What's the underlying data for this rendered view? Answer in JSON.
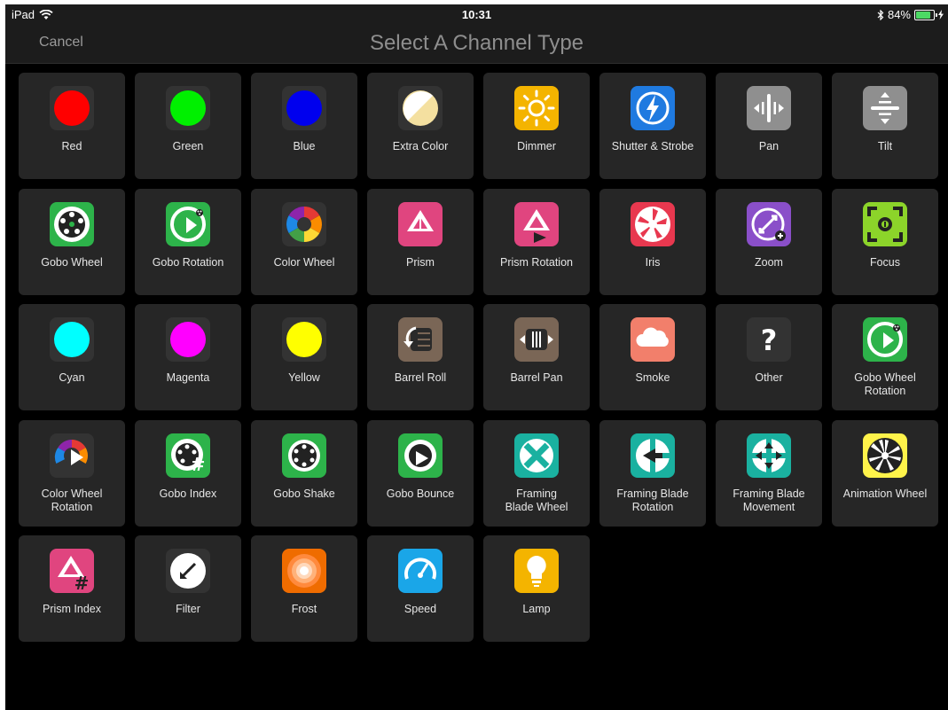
{
  "status_bar": {
    "device": "iPad",
    "time": "10:31",
    "battery_text": "84%",
    "battery_level": 0.84
  },
  "nav": {
    "cancel_label": "Cancel",
    "title": "Select A Channel Type"
  },
  "channels": [
    {
      "label": "Red",
      "icon": "red-color-icon"
    },
    {
      "label": "Green",
      "icon": "green-color-icon"
    },
    {
      "label": "Blue",
      "icon": "blue-color-icon"
    },
    {
      "label": "Extra Color",
      "icon": "extra-color-icon"
    },
    {
      "label": "Dimmer",
      "icon": "dimmer-sun-icon"
    },
    {
      "label": "Shutter & Strobe",
      "icon": "shutter-strobe-bolt-icon"
    },
    {
      "label": "Pan",
      "icon": "pan-icon"
    },
    {
      "label": "Tilt",
      "icon": "tilt-icon"
    },
    {
      "label": "Gobo Wheel",
      "icon": "gobo-wheel-icon"
    },
    {
      "label": "Gobo Rotation",
      "icon": "gobo-rotation-icon"
    },
    {
      "label": "Color Wheel",
      "icon": "color-wheel-icon"
    },
    {
      "label": "Prism",
      "icon": "prism-icon"
    },
    {
      "label": "Prism Rotation",
      "icon": "prism-rotation-icon"
    },
    {
      "label": "Iris",
      "icon": "iris-icon"
    },
    {
      "label": "Zoom",
      "icon": "zoom-icon"
    },
    {
      "label": "Focus",
      "icon": "focus-icon"
    },
    {
      "label": "Cyan",
      "icon": "cyan-color-icon"
    },
    {
      "label": "Magenta",
      "icon": "magenta-color-icon"
    },
    {
      "label": "Yellow",
      "icon": "yellow-color-icon"
    },
    {
      "label": "Barrel Roll",
      "icon": "barrel-roll-icon"
    },
    {
      "label": "Barrel Pan",
      "icon": "barrel-pan-icon"
    },
    {
      "label": "Smoke",
      "icon": "smoke-cloud-icon"
    },
    {
      "label": "Other",
      "icon": "question-mark-icon"
    },
    {
      "label": "Gobo Wheel\nRotation",
      "icon": "gobo-wheel-rotation-icon"
    },
    {
      "label": "Color Wheel\nRotation",
      "icon": "color-wheel-rotation-icon"
    },
    {
      "label": "Gobo Index",
      "icon": "gobo-index-icon"
    },
    {
      "label": "Gobo Shake",
      "icon": "gobo-shake-icon"
    },
    {
      "label": "Gobo Bounce",
      "icon": "gobo-bounce-icon"
    },
    {
      "label": "Framing\nBlade Wheel",
      "icon": "framing-blade-wheel-icon"
    },
    {
      "label": "Framing Blade\nRotation",
      "icon": "framing-blade-rotation-icon"
    },
    {
      "label": "Framing Blade\nMovement",
      "icon": "framing-blade-movement-icon"
    },
    {
      "label": "Animation Wheel",
      "icon": "animation-wheel-icon"
    },
    {
      "label": "Prism Index",
      "icon": "prism-index-icon"
    },
    {
      "label": "Filter",
      "icon": "filter-icon"
    },
    {
      "label": "Frost",
      "icon": "frost-icon"
    },
    {
      "label": "Speed",
      "icon": "speed-gauge-icon"
    },
    {
      "label": "Lamp",
      "icon": "lamp-bulb-icon"
    }
  ]
}
